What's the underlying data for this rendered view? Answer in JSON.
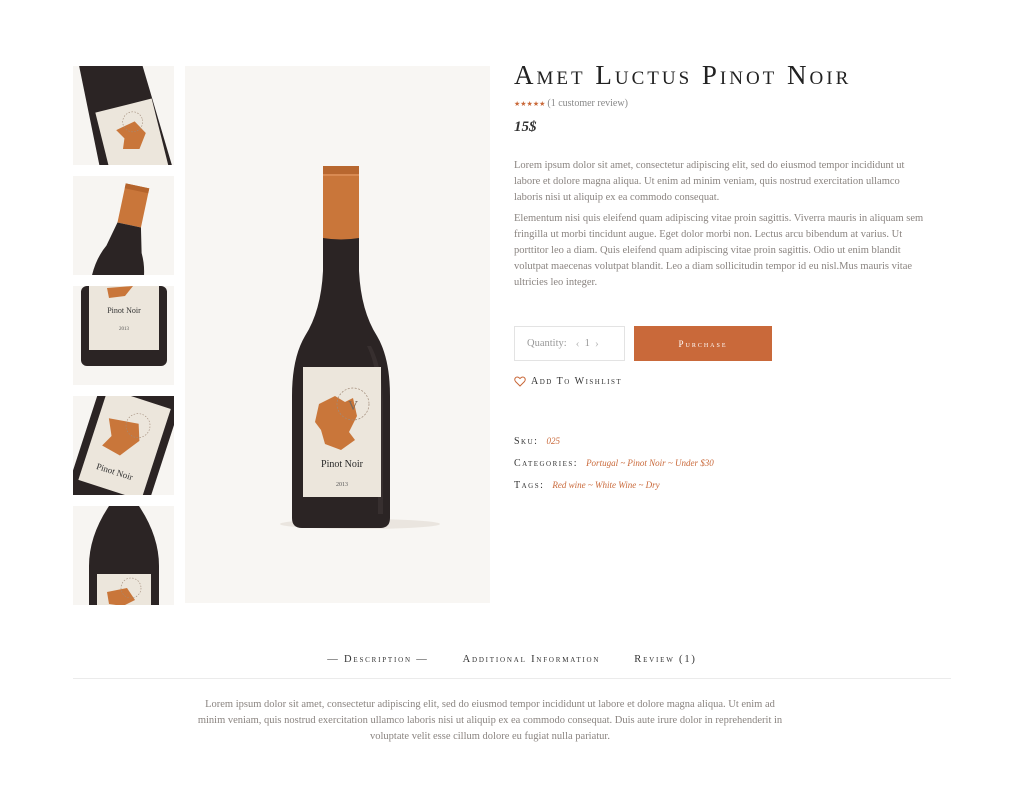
{
  "product": {
    "title": "Amet Luctus Pinot Noir",
    "rating_stars": "★★★★★",
    "review_link": "(1 customer review)",
    "price": "15$",
    "description": [
      "Lorem ipsum dolor sit amet, consectetur adipiscing elit, sed do eiusmod tempor incididunt ut labore et dolore magna aliqua. Ut enim ad minim veniam, quis nostrud exercitation ullamco laboris nisi ut aliquip ex ea commodo consequat.",
      "Elementum nisi quis eleifend quam adipiscing vitae proin sagittis. Viverra mauris in aliquam sem fringilla ut morbi tincidunt augue. Eget dolor morbi non. Lectus arcu bibendum at varius. Ut porttitor leo a diam. Quis eleifend quam adipiscing vitae proin sagittis. Odio ut enim blandit volutpat maecenas volutpat blandit. Leo a diam sollicitudin tempor id eu nisl.Mus mauris vitae ultricies leo integer."
    ],
    "bottle_label": "Pinot Noir",
    "bottle_year": "2013"
  },
  "cart": {
    "quantity_label": "Quantity:",
    "quantity_value": "1",
    "purchase_label": "Purchase",
    "wishlist_label": "Add To Wishlist"
  },
  "meta": {
    "sku_label": "Sku:",
    "sku_value": "025",
    "categories_label": "Categories:",
    "categories_value": "Portugal ~ Pinot Noir ~  Under $30",
    "tags_label": "Tags:",
    "tags_value": "Red wine ~ White Wine ~ Dry"
  },
  "tabs": [
    {
      "label": "— Description —"
    },
    {
      "label": "Additional Information"
    },
    {
      "label": "Review (1)"
    }
  ],
  "tab_content": "Lorem ipsum dolor sit amet, consectetur adipiscing elit, sed do eiusmod tempor incididunt ut labore et dolore magna aliqua. Ut enim ad minim veniam, quis nostrud exercitation ullamco laboris nisi ut aliquip ex ea commodo consequat. Duis aute irure dolor in reprehenderit in voluptate velit esse cillum dolore eu fugiat nulla pariatur.",
  "colors": {
    "accent": "#c9693a",
    "bottle": "#2b2424",
    "capsule": "#c9763a",
    "label": "#ece6dc"
  }
}
